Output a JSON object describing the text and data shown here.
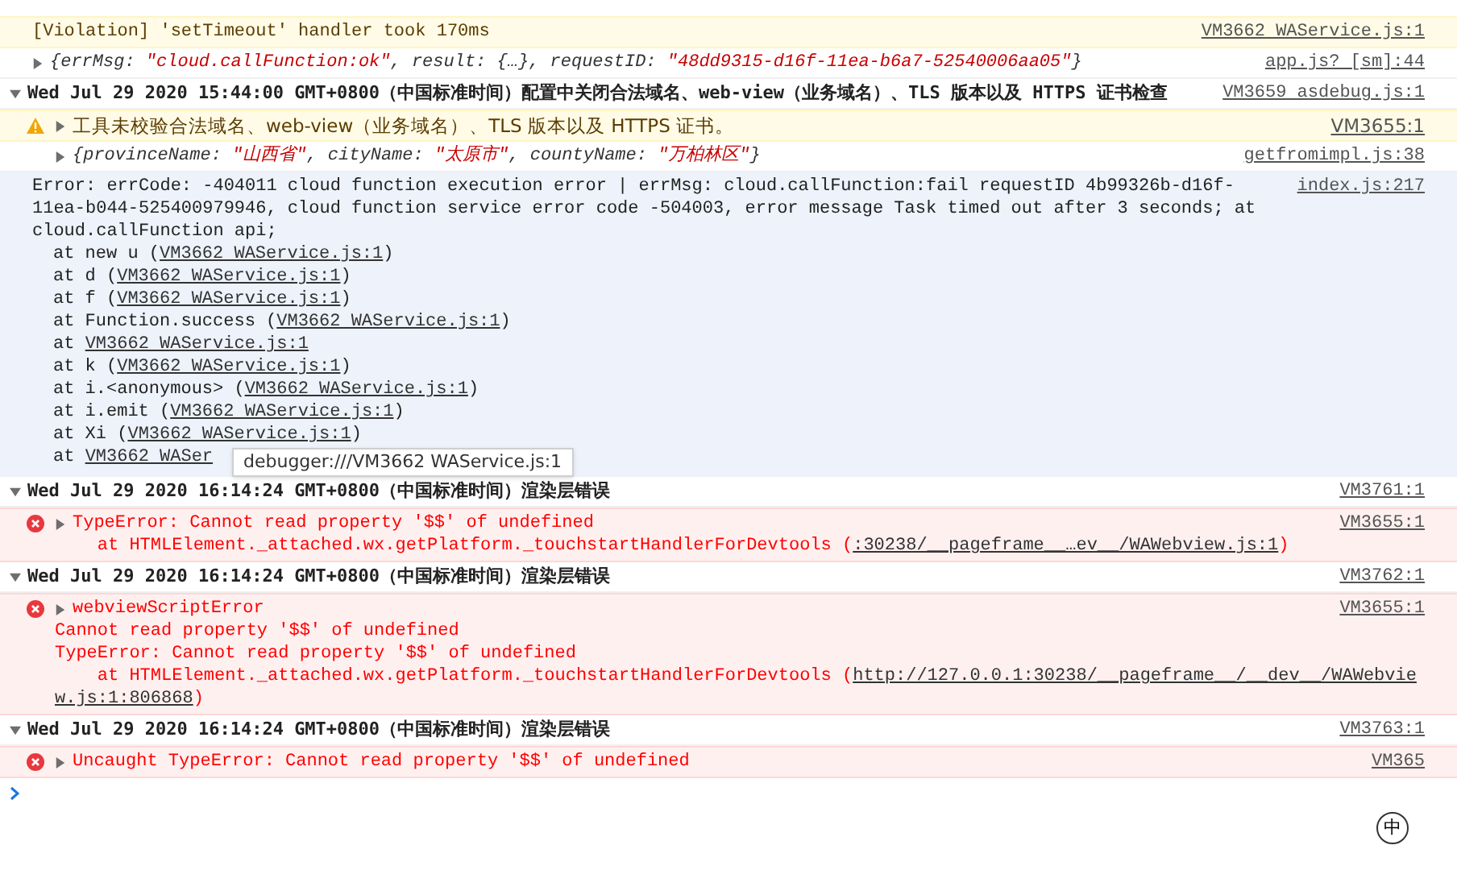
{
  "entries": [
    {
      "kind": "violation",
      "text": "[Violation] 'setTimeout' handler took 170ms",
      "source": "VM3662 WAService.js:1"
    },
    {
      "kind": "object",
      "expanded": false,
      "segments": [
        {
          "kind": "plain",
          "s": "{errMsg: "
        },
        {
          "kind": "string",
          "s": "\"cloud.callFunction:ok\""
        },
        {
          "kind": "plain",
          "s": ", result: {…}, requestID: "
        },
        {
          "kind": "string",
          "s": "\"48dd9315-d16f-11ea-b6a7-52540006aa05\""
        },
        {
          "kind": "plain",
          "s": "}"
        }
      ],
      "source": "app.js? [sm]:44"
    },
    {
      "kind": "group",
      "expanded": true,
      "text": "Wed Jul 29 2020 15:44:00 GMT+0800（中国标准时间）配置中关闭合法域名、web-view（业务域名）、TLS 版本以及 HTTPS 证书检查",
      "source": "VM3659 asdebug.js:1",
      "children": [
        {
          "kind": "warning",
          "expanded": false,
          "text": "工具未校验合法域名、web-view（业务域名）、TLS 版本以及 HTTPS 证书。",
          "source": "VM3655:1"
        },
        {
          "kind": "object",
          "expanded": false,
          "segments": [
            {
              "kind": "plain",
              "s": "{provinceName: "
            },
            {
              "kind": "string",
              "s": "\"山西省\""
            },
            {
              "kind": "plain",
              "s": ", cityName: "
            },
            {
              "kind": "string",
              "s": "\"太原市\""
            },
            {
              "kind": "plain",
              "s": ", countyName: "
            },
            {
              "kind": "string",
              "s": "\"万柏林区\""
            },
            {
              "kind": "plain",
              "s": "}"
            }
          ],
          "source": "getfromimpl.js:38"
        }
      ]
    },
    {
      "kind": "stack",
      "message": "Error: errCode: -404011 cloud function execution error | errMsg: cloud.callFunction:fail requestID 4b99326b-d16f-11ea-b044-525400979946, cloud function service error code -504003, error message Task timed out after 3 seconds; at cloud.callFunction api;",
      "source": "index.js:217",
      "frames": [
        {
          "before": "at new u (",
          "link": "VM3662 WAService.js:1",
          "after": ")"
        },
        {
          "before": "at d (",
          "link": "VM3662 WAService.js:1",
          "after": ")"
        },
        {
          "before": "at f (",
          "link": "VM3662 WAService.js:1",
          "after": ")"
        },
        {
          "before": "at Function.success (",
          "link": "VM3662 WAService.js:1",
          "after": ")"
        },
        {
          "before": "at ",
          "link": "VM3662 WAService.js:1"
        },
        {
          "before": "at k (",
          "link": "VM3662 WAService.js:1",
          "after": ")"
        },
        {
          "before": "at i.<anonymous> (",
          "link": "VM3662 WAService.js:1",
          "after": ")"
        },
        {
          "before": "at i.emit (",
          "link": "VM3662 WAService.js:1",
          "after": ")"
        },
        {
          "before": "at Xi (",
          "link": "VM3662 WAService.js:1",
          "after": ")"
        },
        {
          "before": "at ",
          "link": "VM3662 WASer"
        }
      ],
      "tooltip": "debugger:///VM3662 WAService.js:1"
    },
    {
      "kind": "group",
      "expanded": true,
      "text": "Wed Jul 29 2020 16:14:24 GMT+0800（中国标准时间）渲染层错误",
      "source": "VM3761:1",
      "children": [
        {
          "kind": "error",
          "expanded": false,
          "text": "TypeError: Cannot read property '$$' of undefined",
          "at": {
            "before": "    at HTMLElement._attached.wx.getPlatform._touchstartHandlerForDevtools (",
            "link": ":30238/__pageframe__…ev__/WAWebview.js:1",
            "after": ")"
          },
          "source": "VM3655:1"
        }
      ]
    },
    {
      "kind": "group",
      "expanded": true,
      "text": "Wed Jul 29 2020 16:14:24 GMT+0800（中国标准时间）渲染层错误",
      "source": "VM3762:1",
      "children": [
        {
          "kind": "error",
          "expanded": false,
          "text": "webviewScriptError",
          "lines": [
            "Cannot read property '$$' of undefined",
            "TypeError: Cannot read property '$$' of undefined"
          ],
          "at": {
            "before": "    at HTMLElement._attached.wx.getPlatform._touchstartHandlerForDevtools (",
            "link": "http://127.0.0.1:30238/__pageframe__/__dev__/WAWebvie",
            "link_end": "w.js:1:806868",
            "after": ")"
          },
          "source": "VM3655:1"
        }
      ]
    },
    {
      "kind": "group",
      "expanded": true,
      "text": "Wed Jul 29 2020 16:14:24 GMT+0800（中国标准时间）渲染层错误",
      "source": "VM3763:1",
      "children": [
        {
          "kind": "error",
          "expanded": false,
          "text": "Uncaught TypeError: Cannot read property '$$' of undefined",
          "source": "VM365"
        }
      ]
    }
  ],
  "ime_badge": "中"
}
